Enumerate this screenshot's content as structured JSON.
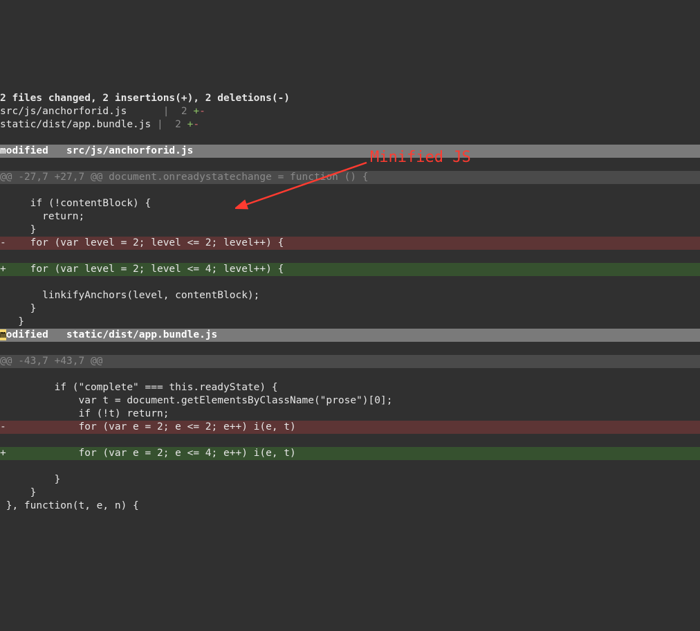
{
  "top_truncated": "",
  "summary": {
    "line": "2 files changed, 2 insertions(+), 2 deletions(-)",
    "stat1_path": "src/js/anchorforid.js      ",
    "stat1_bar": "|  2 ",
    "stat2_path": "static/dist/app.bundle.js ",
    "stat2_bar": "|  2 "
  },
  "file1": {
    "header": "modified   src/js/anchorforid.js",
    "hunk": "@@ -27,7 +27,7 @@ document.onreadystatechange = function () {",
    "ctx1": "     if (!contentBlock) {",
    "ctx2": "       return;",
    "ctx3": "     }",
    "del": "-    for (var level = 2; level <= 2; level++) {",
    "add": "+    for (var level = 2; level <= 4; level++) {",
    "ctx4": "       linkifyAnchors(level, contentBlock);",
    "ctx5": "     }",
    "ctx6": "   }"
  },
  "file2": {
    "header_pre": "m",
    "header_rest": "odified   static/dist/app.bundle.js",
    "hunk": "@@ -43,7 +43,7 @@",
    "ctx1": "         if (\"complete\" === this.readyState) {",
    "ctx2": "             var t = document.getElementsByClassName(\"prose\")[0];",
    "ctx3": "             if (!t) return;",
    "del": "-            for (var e = 2; e <= 2; e++) i(e, t)",
    "add": "+            for (var e = 2; e <= 4; e++) i(e, t)",
    "ctx4": "         }",
    "ctx5": "     }",
    "ctx6": " }, function(t, e, n) {"
  },
  "annotation": "Minified JS",
  "pm": {
    "plus": "+",
    "minus": "-"
  }
}
